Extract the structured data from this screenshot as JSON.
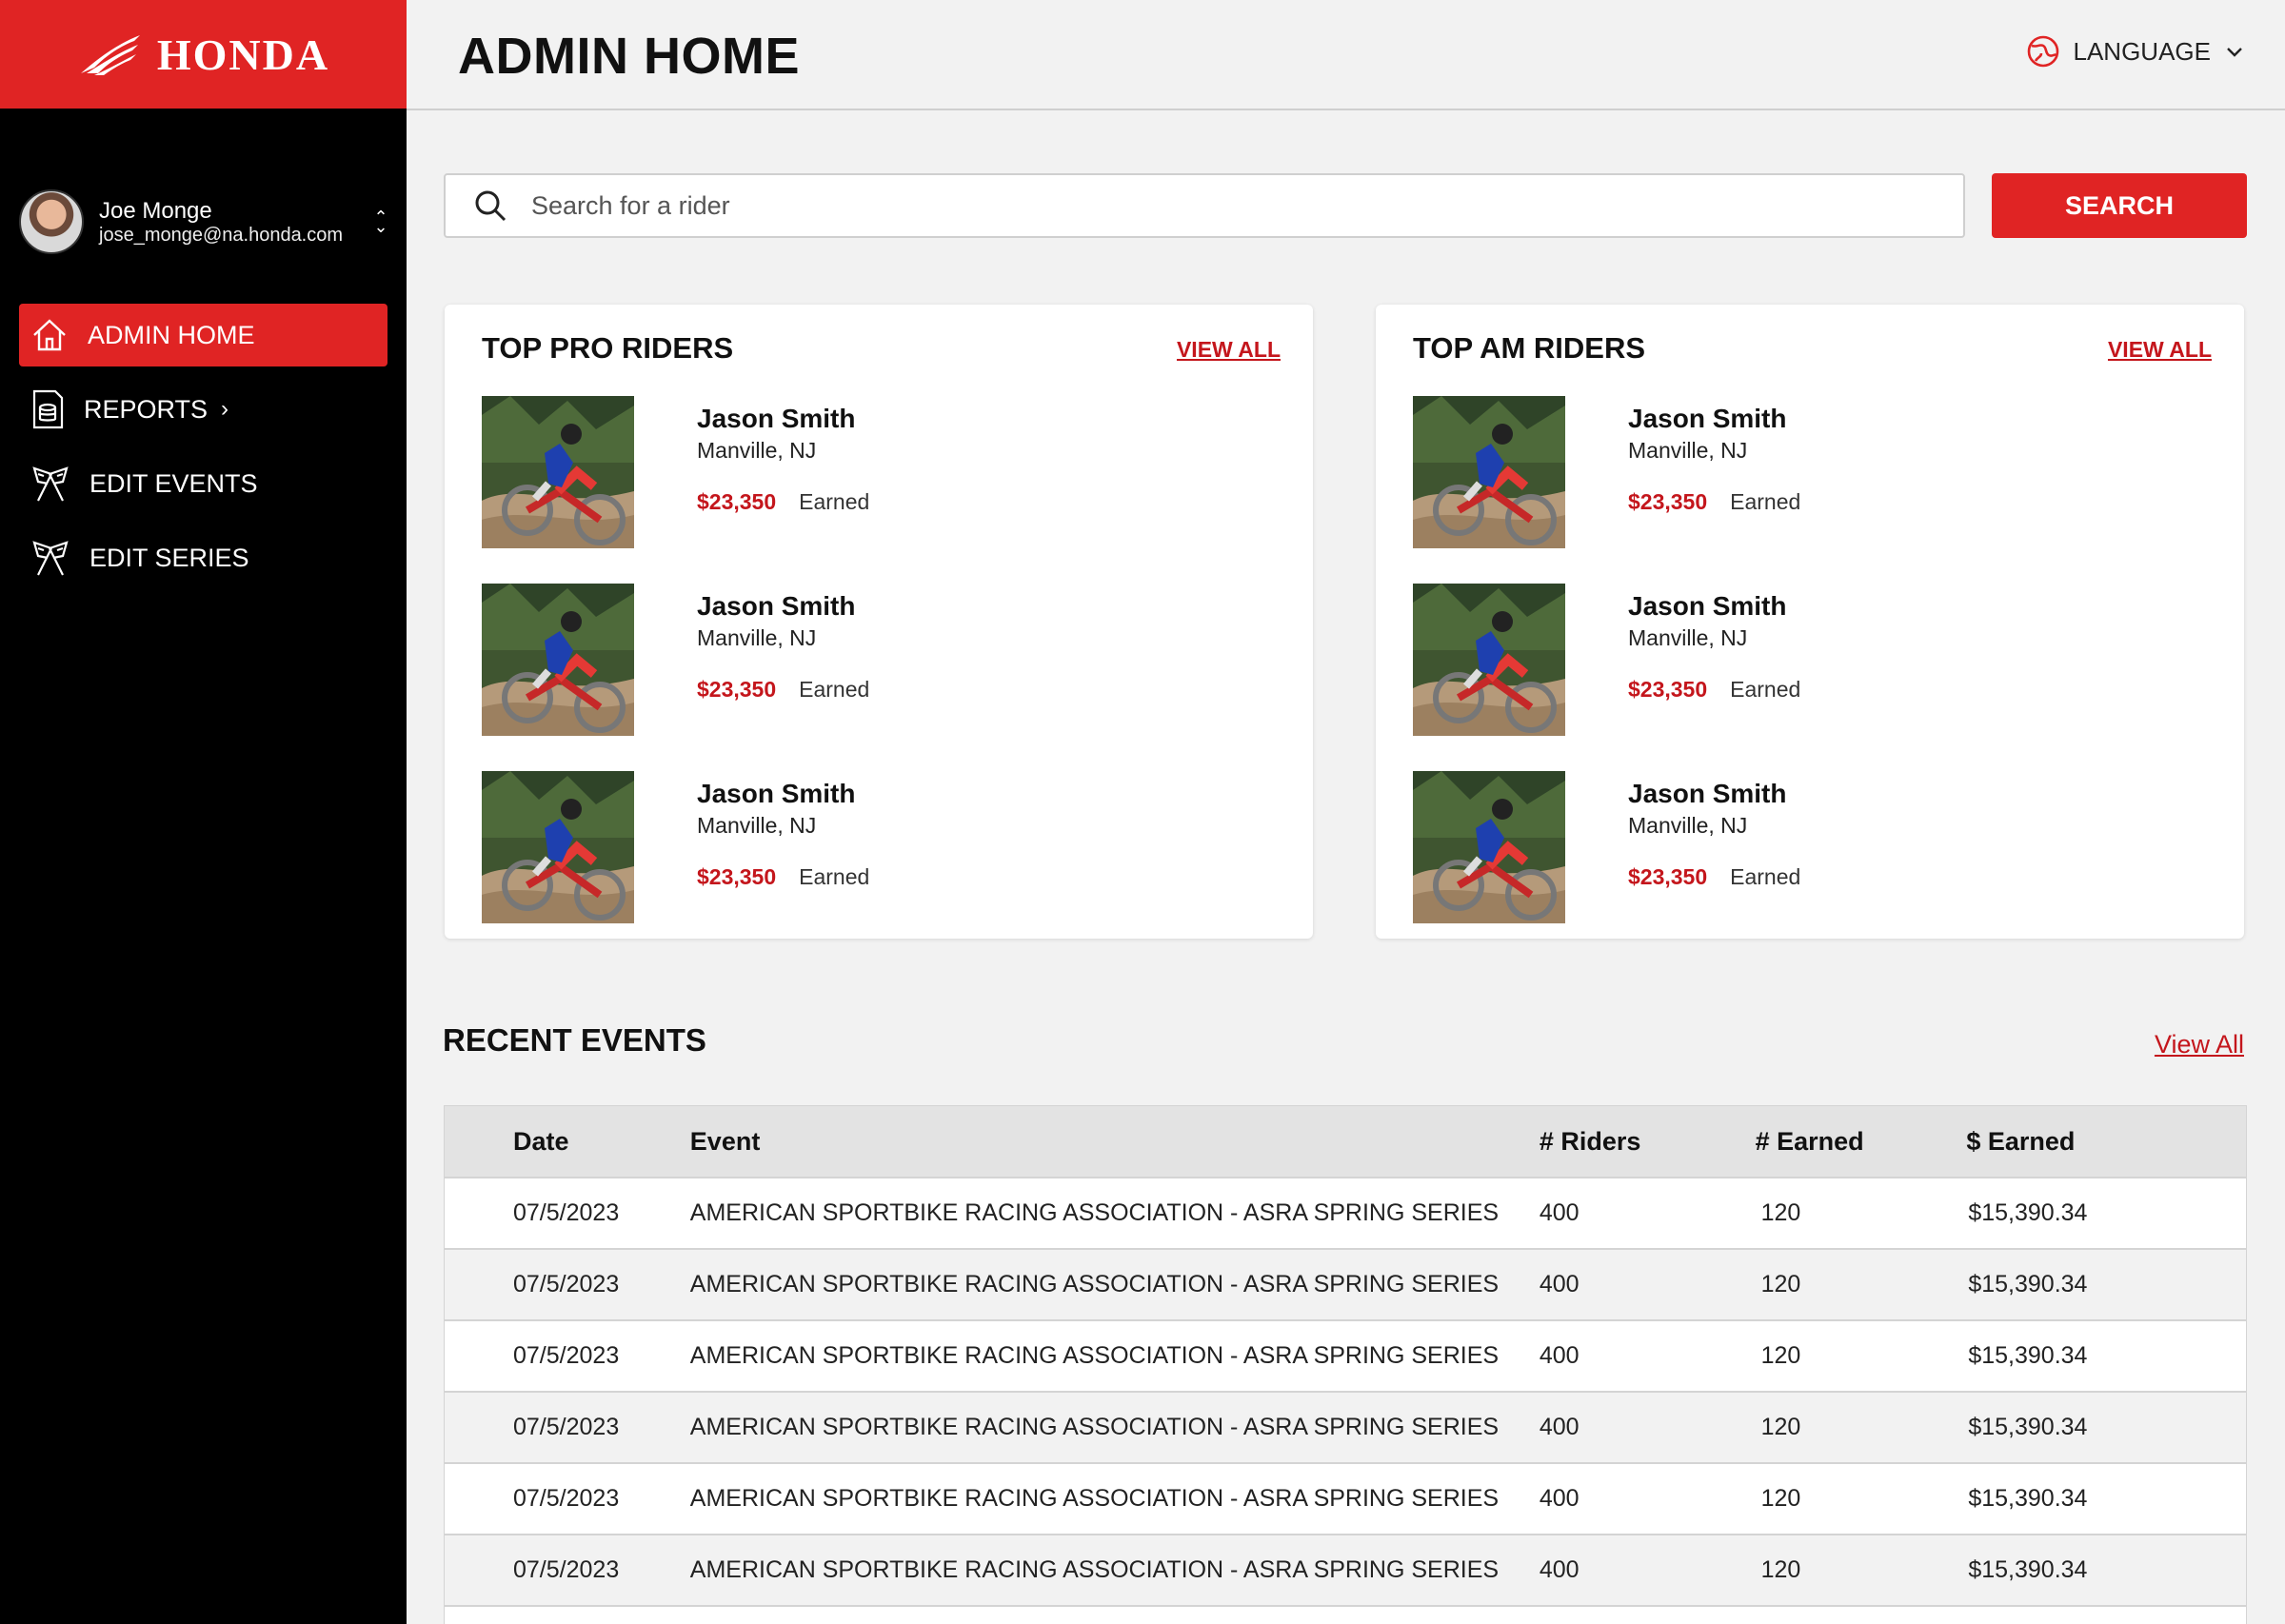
{
  "brand": {
    "name": "HONDA",
    "accent": "#e02424"
  },
  "header": {
    "title": "ADMIN HOME",
    "language_label": "LANGUAGE"
  },
  "user": {
    "name": "Joe Monge",
    "email": "jose_monge@na.honda.com"
  },
  "nav": {
    "items": [
      {
        "label": "ADMIN HOME",
        "icon": "home-icon",
        "active": true
      },
      {
        "label": "REPORTS",
        "icon": "database-icon"
      },
      {
        "label": "EDIT EVENTS",
        "icon": "checkered-flags-icon"
      },
      {
        "label": "EDIT SERIES",
        "icon": "checkered-flags-icon"
      }
    ]
  },
  "search": {
    "placeholder": "Search for a rider",
    "button_label": "SEARCH"
  },
  "top_pro": {
    "title": "TOP PRO RIDERS",
    "view_all": "VIEW ALL",
    "riders": [
      {
        "name": "Jason Smith",
        "location": "Manville, NJ",
        "amount": "$23,350",
        "earned_label": "Earned"
      },
      {
        "name": "Jason Smith",
        "location": "Manville, NJ",
        "amount": "$23,350",
        "earned_label": "Earned"
      },
      {
        "name": "Jason Smith",
        "location": "Manville, NJ",
        "amount": "$23,350",
        "earned_label": "Earned"
      }
    ]
  },
  "top_am": {
    "title": "TOP AM RIDERS",
    "view_all": "VIEW ALL",
    "riders": [
      {
        "name": "Jason Smith",
        "location": "Manville, NJ",
        "amount": "$23,350",
        "earned_label": "Earned"
      },
      {
        "name": "Jason Smith",
        "location": "Manville, NJ",
        "amount": "$23,350",
        "earned_label": "Earned"
      },
      {
        "name": "Jason Smith",
        "location": "Manville, NJ",
        "amount": "$23,350",
        "earned_label": "Earned"
      }
    ]
  },
  "events": {
    "title": "RECENT EVENTS",
    "view_all": "View All",
    "columns": [
      "Date",
      "Event",
      "# Riders",
      "# Earned",
      "$ Earned"
    ],
    "rows": [
      [
        "07/5/2023",
        "AMERICAN SPORTBIKE RACING ASSOCIATION - ASRA SPRING SERIES",
        "400",
        "120",
        "$15,390.34"
      ],
      [
        "07/5/2023",
        "AMERICAN SPORTBIKE RACING ASSOCIATION - ASRA SPRING SERIES",
        "400",
        "120",
        "$15,390.34"
      ],
      [
        "07/5/2023",
        "AMERICAN SPORTBIKE RACING ASSOCIATION - ASRA SPRING SERIES",
        "400",
        "120",
        "$15,390.34"
      ],
      [
        "07/5/2023",
        "AMERICAN SPORTBIKE RACING ASSOCIATION - ASRA SPRING SERIES",
        "400",
        "120",
        "$15,390.34"
      ],
      [
        "07/5/2023",
        "AMERICAN SPORTBIKE RACING ASSOCIATION - ASRA SPRING SERIES",
        "400",
        "120",
        "$15,390.34"
      ],
      [
        "07/5/2023",
        "AMERICAN SPORTBIKE RACING ASSOCIATION - ASRA SPRING SERIES",
        "400",
        "120",
        "$15,390.34"
      ]
    ]
  }
}
